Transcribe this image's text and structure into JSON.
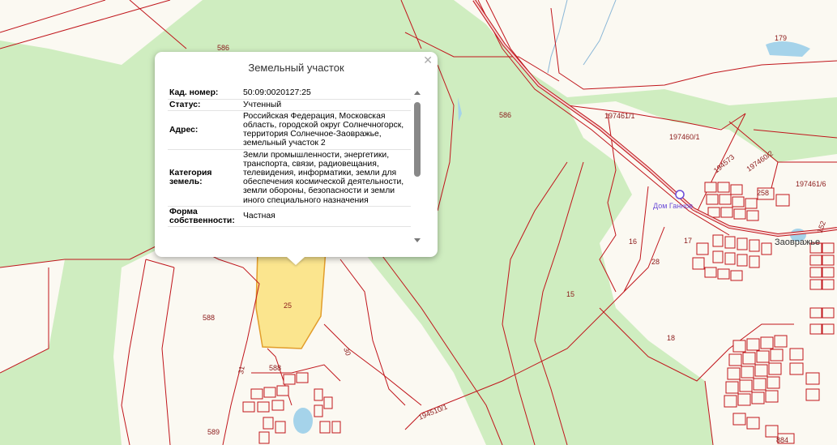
{
  "popup": {
    "title": "Земельный участок",
    "close_icon": "close-icon",
    "rows": [
      {
        "label": "Кад. номер:",
        "value": "50:09:0020127:25"
      },
      {
        "label": "Статус:",
        "value": "Учтенный"
      },
      {
        "label": "Адрес:",
        "value": "Российская Федерация, Московская область, городской округ Солнечногорск, территория Солнечное-Заовражье, земельный участок 2"
      },
      {
        "label": "Категория земель:",
        "value": "Земли промышленности, энергетики, транспорта, связи, радиовещания, телевидения, информатики, земли для обеспечения космической деятельности, земли обороны, безопасности и земли иного специального назначения"
      },
      {
        "label": "Форма собственности:",
        "value": "Частная"
      }
    ]
  },
  "map": {
    "parcel_labels": [
      "586",
      "586",
      "179",
      "586",
      "197461/1",
      "197460/1",
      "197460/2",
      "194573",
      "258",
      "197461/6",
      "16",
      "17",
      "28",
      "15",
      "18",
      "25",
      "588",
      "588",
      "30",
      "31",
      "589",
      "194510/1",
      "884",
      "152"
    ],
    "place_label": "Заовражье",
    "poi_label": "Дом Ганнов",
    "colors": {
      "forest": "#cfedc0",
      "open": "#fbf9f2",
      "parcel_line": "#c0151b",
      "water": "#a5d3ea",
      "selected_parcel": "#fbe58e"
    }
  }
}
